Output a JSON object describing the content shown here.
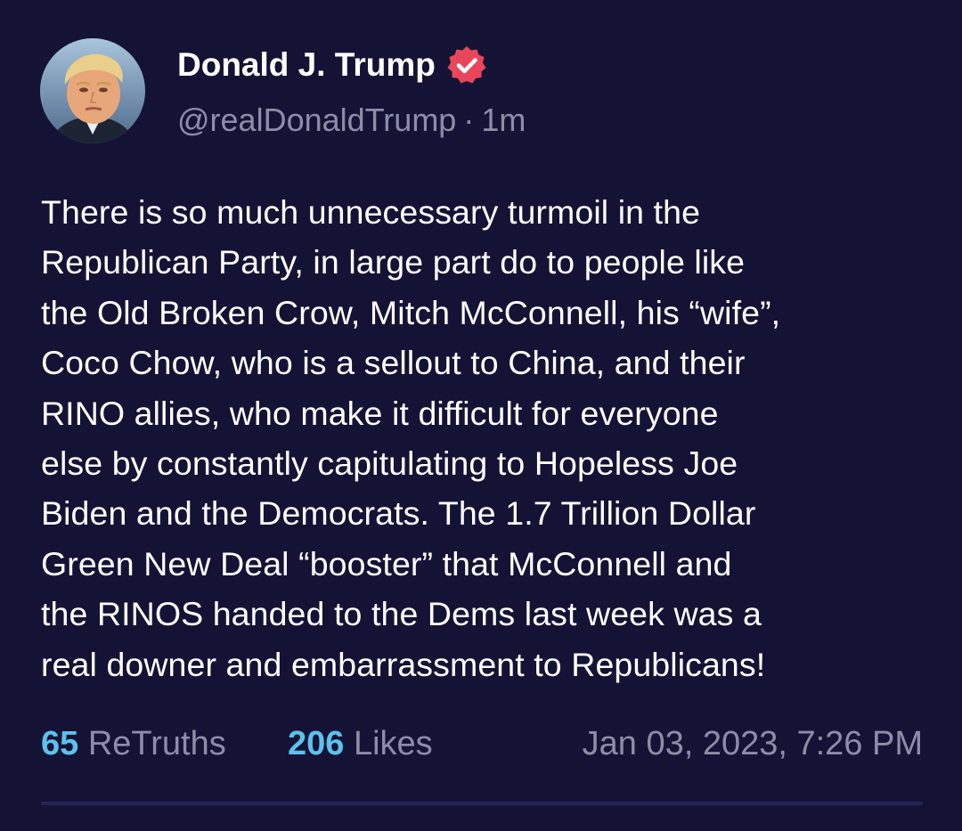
{
  "post": {
    "author": {
      "display_name": "Donald J. Trump",
      "handle": "@realDonaldTrump",
      "verified": true
    },
    "relative_time": "1m",
    "meta_separator": "·",
    "body_lines": [
      "There is so much unnecessary turmoil in the",
      "Republican Party, in large part do to people like",
      "the Old Broken Crow, Mitch McConnell, his “wife”,",
      "Coco Chow, who is a sellout to China, and their",
      "RINO allies, who make it difficult for everyone",
      "else by constantly capitulating to Hopeless Joe",
      "Biden and the Democrats. The 1.7 Trillion Dollar",
      "Green New Deal “booster” that McConnell and",
      "the RINOS handed to the Dems last week was a",
      "real downer and embarrassment to Republicans!"
    ],
    "stats": {
      "retruths_count": "65",
      "retruths_label": "ReTruths",
      "likes_count": "206",
      "likes_label": "Likes"
    },
    "timestamp": "Jan 03, 2023, 7:26 PM"
  },
  "colors": {
    "background": "#141335",
    "accent": "#5cc1ec",
    "muted_text": "#8e8da8",
    "verified_badge": "#e8465a"
  },
  "icons": {
    "verified": "verified-badge-icon",
    "avatar": "user-avatar"
  }
}
